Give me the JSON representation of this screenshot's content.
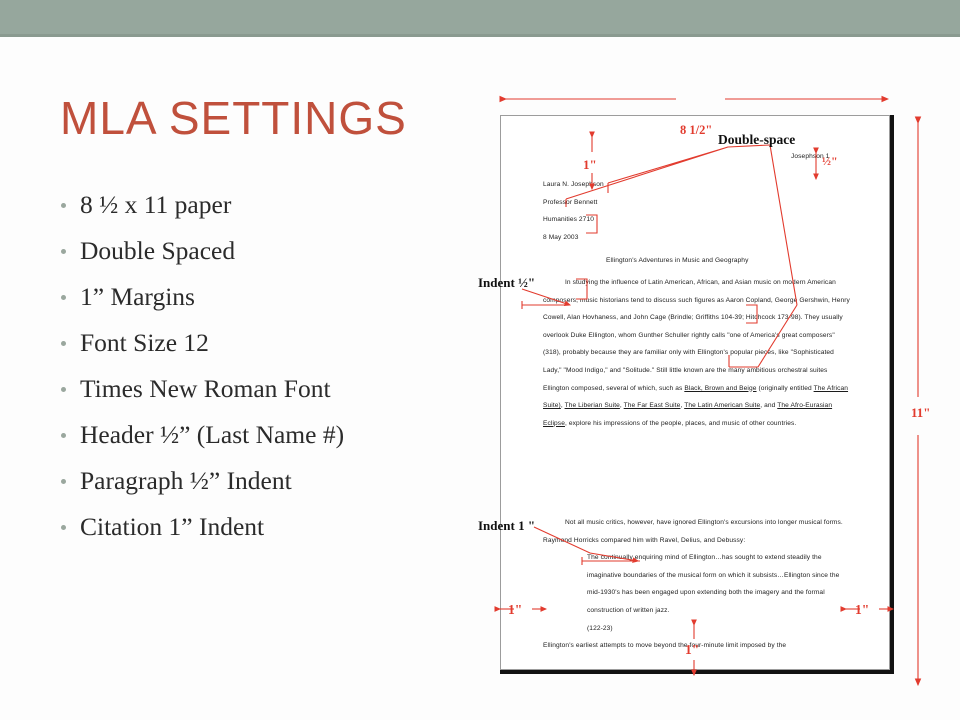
{
  "slide": {
    "title": "MLA  SETTINGS",
    "accent_color": "#c0503c",
    "bar_color": "#96a79d",
    "annotation_color": "#e23b2e",
    "bullets": [
      "8 ½ x 11 paper",
      "Double Spaced",
      "1” Margins",
      "Font Size 12",
      "Times New Roman Font",
      "Header ½” (Last Name #)",
      "Paragraph ½” Indent",
      "Citation 1” Indent"
    ]
  },
  "diagram": {
    "annotations": {
      "page_width": "8 1/2\"",
      "page_height": "11\"",
      "top_margin": "1\"",
      "bottom_margin": "1\"",
      "left_margin": "1\"",
      "right_margin": "1\"",
      "header_offset": "½\"",
      "double_space": "Double-space",
      "indent_half": "Indent ½\"",
      "indent_one": "Indent 1 \""
    },
    "paper": {
      "running_header": "Josephson 1",
      "heading_block": [
        "Laura N. Josephson",
        "Professor Bennett",
        "Humanities 2710",
        "8 May 2003"
      ],
      "essay_title": "Ellington's Adventures in Music and Geography",
      "body_paragraph": "In studying the influence of Latin American, African, and Asian music on modern American composers, music historians tend to discuss such figures as Aaron Copland, George Gershwin, Henry Cowell, Alan Hovhaness, and John Cage (Brindle; Griffiths 104-39; Hitchcock 173-98). They usually overlook Duke Ellington, whom Gunther Schuller rightly calls \"one of America's great composers\" (318), probably because they are familiar only with Ellington's popular pieces, like \"Sophisticated Lady,\" \"Mood Indigo,\" and \"Solitude.\"  Still little known are the many ambitious orchestral suites Ellington composed, several of which, such as ",
      "body_titles_1": "Black, Brown and Beige",
      "body_mid_1": " (originally entitled ",
      "body_titles_2": "The African Suite)",
      "body_mid_2": ", ",
      "body_titles_3": "The Liberian Suite",
      "body_mid_3": ", ",
      "body_titles_4": "The Far East Suite",
      "body_mid_4": ", ",
      "body_titles_5": "The Latin American Suite",
      "body_mid_5": ", and ",
      "body_titles_6": "The Afro-Eurasian Eclipse",
      "body_tail": ", explore his impressions of the people, places, and music of other countries.",
      "second_paragraph": "Not all music critics, however, have ignored Ellington's excursions into longer musical forms.  Raymond Horricks compared him with Ravel, Delius, and Debussy:",
      "block_quote": "The continually enquiring mind of Ellington…has sought to extend steadily the imaginative boundaries of the musical form on which it subsists…Ellington since the mid-1930's has been engaged upon extending both the imagery and the formal construction of written jazz.",
      "block_quote_citation": "(122-23)",
      "last_line": "Ellington's earliest attempts to move beyond the four-minute limit imposed by the"
    }
  }
}
